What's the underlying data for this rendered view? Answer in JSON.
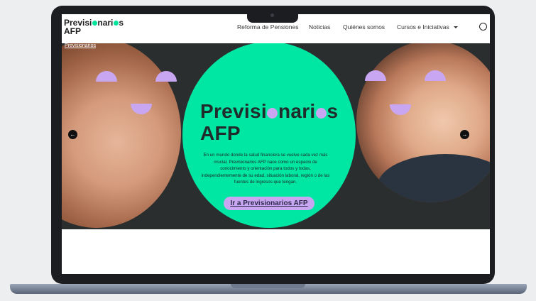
{
  "header": {
    "logo_part1": "Previsi",
    "logo_part2": "nari",
    "logo_part3": "s",
    "logo_line2": "AFP",
    "nav": [
      {
        "label": "Reforma de Pensiones"
      },
      {
        "label": "Noticias"
      },
      {
        "label": "Quiénes somos"
      },
      {
        "label": "Cursos e Iniciativas"
      }
    ]
  },
  "breadcrumb": "Previsionarios",
  "hero": {
    "title_part1": "Previsi",
    "title_part2": "nari",
    "title_part3": "s",
    "title_line2": "AFP",
    "description": "En un mundo donde la salud financiera se vuelve cada vez más crucial, Previsionarios AFP nace como un espacio de conocimiento y orientación para todos y todas, independientemente de su edad, situación laboral, región o de las fuentes de ingresos que tengan.",
    "cta_label": "Ir a Previsionarios AFP",
    "prev_arrow": "←",
    "next_arrow": "→"
  },
  "colors": {
    "accent_green": "#00e6a3",
    "accent_purple": "#c9a6f2",
    "hero_background": "#2b2e2e"
  },
  "icons": [
    "search-icon",
    "chevron-down-icon",
    "arrow-left-icon",
    "arrow-right-icon"
  ]
}
